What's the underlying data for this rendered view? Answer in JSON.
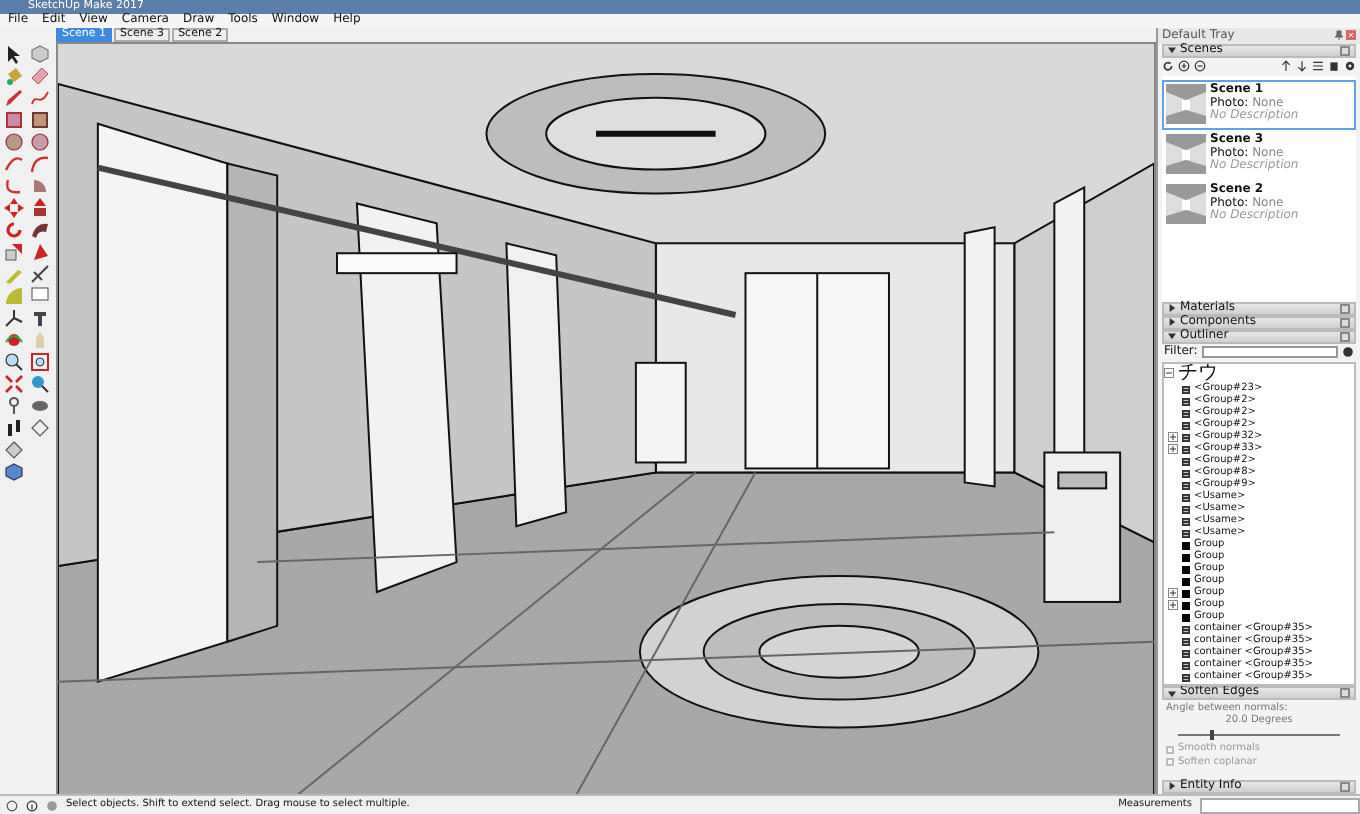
{
  "window": {
    "title": "SketchUp Make 2017"
  },
  "menu": [
    "File",
    "Edit",
    "View",
    "Camera",
    "Draw",
    "Tools",
    "Window",
    "Help"
  ],
  "scene_tabs": [
    {
      "label": "Scene 1",
      "selected": true
    },
    {
      "label": "Scene 3",
      "selected": false
    },
    {
      "label": "Scene 2",
      "selected": false
    }
  ],
  "tray": {
    "title": "Default Tray",
    "scenes": {
      "title": "Scenes",
      "expanded": true,
      "items": [
        {
          "name": "Scene 1",
          "photo_label": "Photo:",
          "photo_value": "None",
          "description": "No Description",
          "selected": true
        },
        {
          "name": "Scene 3",
          "photo_label": "Photo:",
          "photo_value": "None",
          "description": "No Description",
          "selected": false
        },
        {
          "name": "Scene 2",
          "photo_label": "Photo:",
          "photo_value": "None",
          "description": "No Description",
          "selected": false
        }
      ]
    },
    "sections": [
      {
        "title": "Materials",
        "expanded": false
      },
      {
        "title": "Components",
        "expanded": false
      },
      {
        "title": "Outliner",
        "expanded": true
      }
    ],
    "outliner": {
      "filter_label": "Filter:",
      "root": {
        "label": "チウ",
        "expanded": true,
        "children": [
          {
            "label": "<Group#23>",
            "kind": "component",
            "expander": false
          },
          {
            "label": "<Group#2>",
            "kind": "component",
            "expander": false
          },
          {
            "label": "<Group#2>",
            "kind": "component",
            "expander": false
          },
          {
            "label": "<Group#2>",
            "kind": "component",
            "expander": false
          },
          {
            "label": "<Group#32>",
            "kind": "component",
            "expander": true
          },
          {
            "label": "<Group#33>",
            "kind": "component",
            "expander": true
          },
          {
            "label": "<Group#2>",
            "kind": "component",
            "expander": false
          },
          {
            "label": "<Group#8>",
            "kind": "component",
            "expander": false
          },
          {
            "label": "<Group#9>",
            "kind": "component",
            "expander": false
          },
          {
            "label": "<Usame>",
            "kind": "component",
            "expander": false
          },
          {
            "label": "<Usame>",
            "kind": "component",
            "expander": false
          },
          {
            "label": "<Usame>",
            "kind": "component",
            "expander": false
          },
          {
            "label": "<Usame>",
            "kind": "component",
            "expander": false
          },
          {
            "label": "Group",
            "kind": "group",
            "expander": false
          },
          {
            "label": "Group",
            "kind": "group",
            "expander": false
          },
          {
            "label": "Group",
            "kind": "group",
            "expander": false
          },
          {
            "label": "Group",
            "kind": "group",
            "expander": false
          },
          {
            "label": "Group",
            "kind": "group",
            "expander": true
          },
          {
            "label": "Group",
            "kind": "group",
            "expander": true
          },
          {
            "label": "Group",
            "kind": "group",
            "expander": false
          },
          {
            "label": "container <Group#35>",
            "kind": "component",
            "expander": false
          },
          {
            "label": "container <Group#35>",
            "kind": "component",
            "expander": false
          },
          {
            "label": "container <Group#35>",
            "kind": "component",
            "expander": false
          },
          {
            "label": "container <Group#35>",
            "kind": "component",
            "expander": false
          },
          {
            "label": "container <Group#35>",
            "kind": "component",
            "expander": false
          }
        ]
      }
    },
    "soften_edges": {
      "title": "Soften Edges",
      "expanded": true,
      "angle_label": "Angle between normals:",
      "angle_value": "20.0  Degrees",
      "level": 0.2,
      "options": [
        {
          "label": "Smooth normals",
          "checked": false,
          "disabled": true
        },
        {
          "label": "Soften coplanar",
          "checked": false,
          "disabled": true
        }
      ]
    },
    "entity_info": {
      "title": "Entity Info",
      "expanded": false
    }
  },
  "status_bar": {
    "message": "Select objects. Shift to extend select. Drag mouse to select multiple.",
    "measurements_label": "Measurements"
  }
}
